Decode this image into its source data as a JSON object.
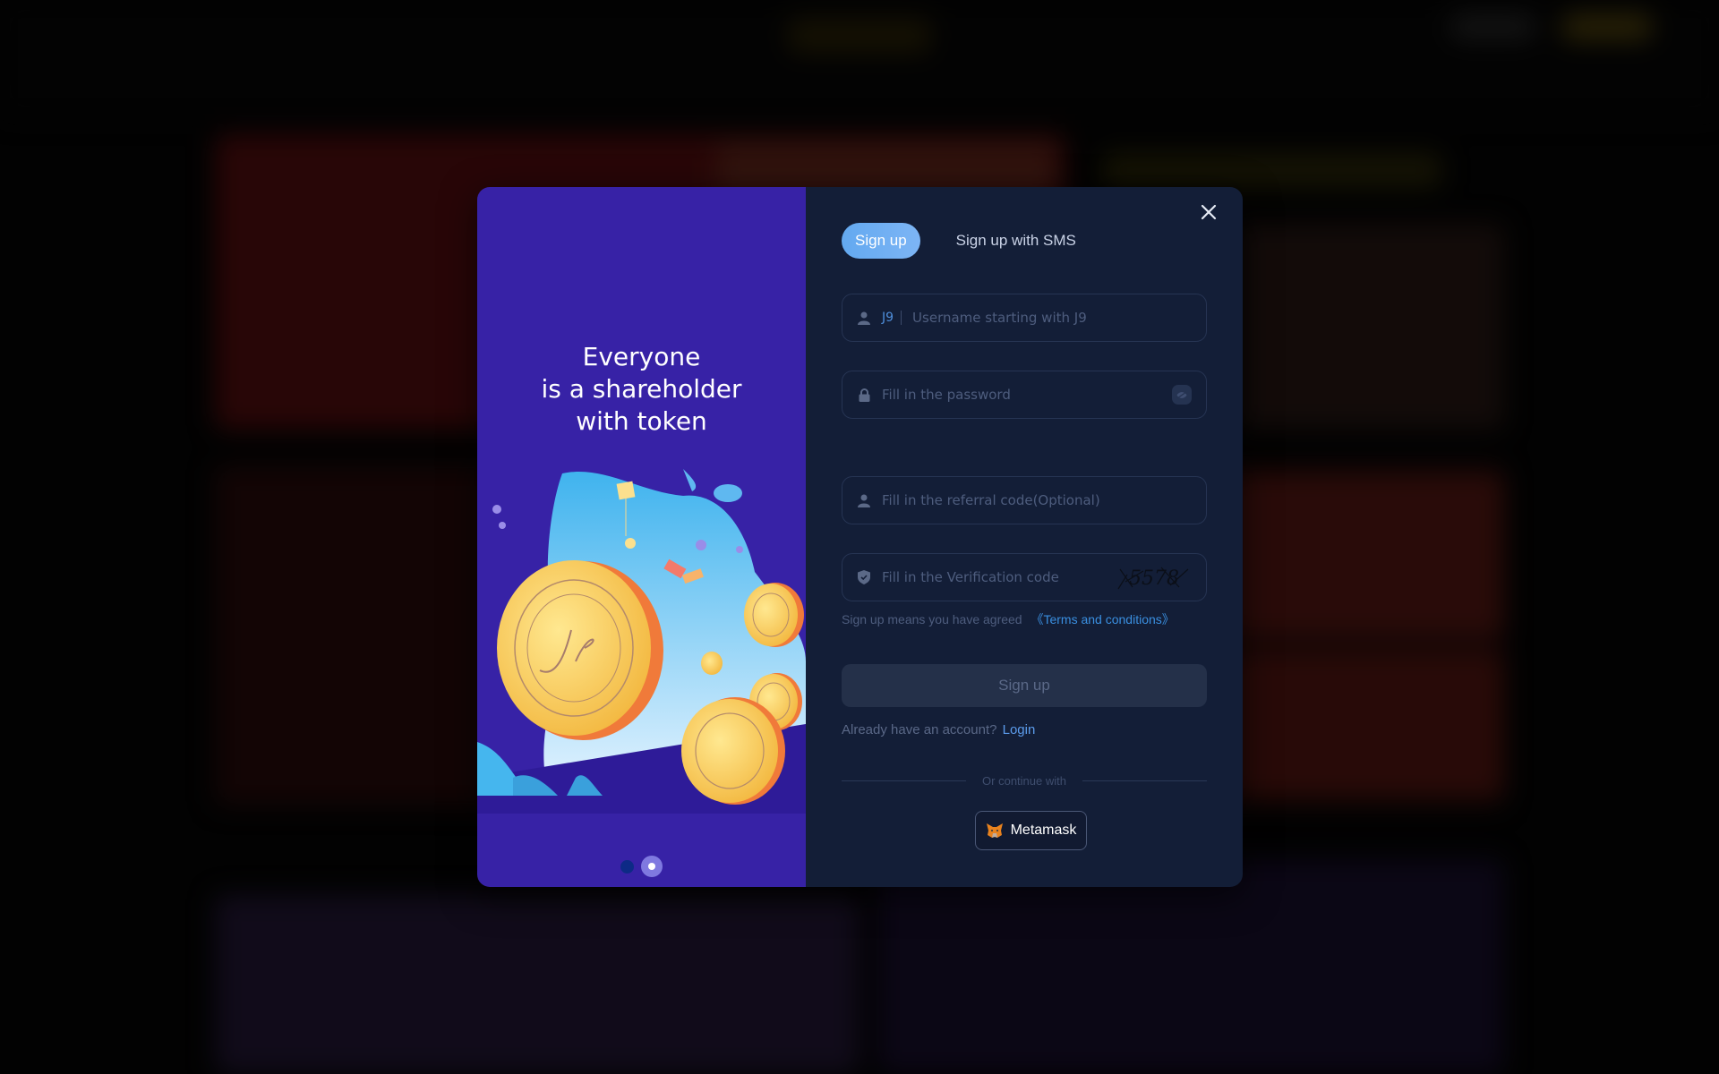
{
  "promo": {
    "title_lines": [
      "Everyone",
      "is a shareholder",
      "with token"
    ],
    "carousel": {
      "total": 2,
      "active_index": 2
    }
  },
  "tabs": [
    {
      "label": "Sign up",
      "active": true
    },
    {
      "label": "Sign up with SMS",
      "active": false
    }
  ],
  "form": {
    "username": {
      "prefix": "J9",
      "placeholder": "Username starting with J9",
      "value": ""
    },
    "password": {
      "placeholder": "Fill in the password",
      "value": ""
    },
    "referral": {
      "placeholder": "Fill in the referral code(Optional)",
      "value": ""
    },
    "verification": {
      "placeholder": "Fill in the Verification code",
      "value": "",
      "captcha_text": "5578"
    },
    "terms_text": "Sign up means you have agreed",
    "terms_link": "《Terms and conditions》",
    "submit_label": "Sign up",
    "login_prompt": "Already have an account?",
    "login_link": "Login",
    "divider_text": "Or continue with",
    "metamask_label": "Metamask"
  },
  "colors": {
    "promo_bg": "#3722a6",
    "form_bg": "#131e37",
    "accent": "#63a9f0",
    "link": "#3a8fe0"
  }
}
